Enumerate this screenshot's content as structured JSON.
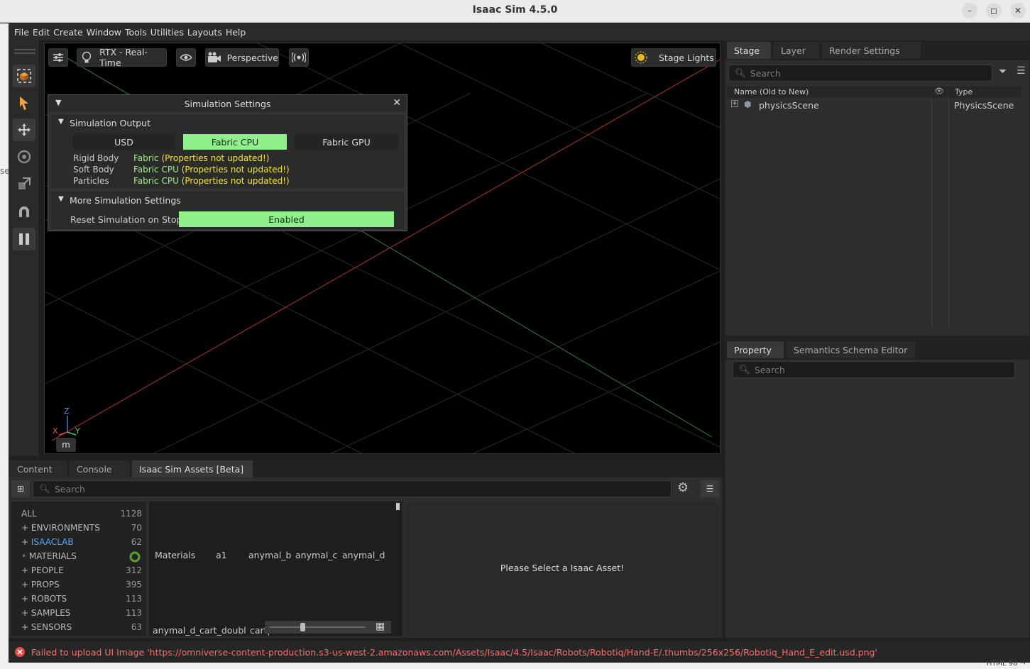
{
  "window": {
    "title": "Isaac Sim 4.5.0"
  },
  "menu": [
    "File",
    "Edit",
    "Create",
    "Window",
    "Tools",
    "Utilities",
    "Layouts",
    "Help"
  ],
  "left_edge_cut_text": "se",
  "viewport": {
    "render_mode": "RTX - Real-Time",
    "camera": "Perspective",
    "lights": "Stage Lights",
    "unit": "m",
    "axes": {
      "z": "Z",
      "x": "X",
      "y": "Y"
    }
  },
  "sim_settings": {
    "title": "Simulation Settings",
    "output_section": "Simulation Output",
    "modes": [
      "USD",
      "Fabric CPU",
      "Fabric GPU"
    ],
    "selected_mode": "Fabric CPU",
    "rows": [
      {
        "label": "Rigid Body",
        "value": "Fabric",
        "note": "(Properties not updated!)"
      },
      {
        "label": "Soft Body",
        "value": "Fabric CPU",
        "note": "(Properties not updated!)"
      },
      {
        "label": "Particles",
        "value": "Fabric CPU",
        "note": "(Properties not updated!)"
      }
    ],
    "more_section": "More Simulation Settings",
    "reset_label": "Reset Simulation on Stop",
    "reset_value": "Enabled"
  },
  "stage": {
    "tabs": [
      "Stage",
      "Layer",
      "Render Settings"
    ],
    "search_placeholder": "Search",
    "col_name": "Name (Old to New)",
    "col_type": "Type",
    "items": [
      {
        "name": "physicsScene",
        "type": "PhysicsScene"
      }
    ]
  },
  "property": {
    "tabs": [
      "Property",
      "Semantics Schema Editor"
    ],
    "search_placeholder": "Search"
  },
  "assets": {
    "tabs": [
      "Content",
      "Console",
      "Isaac Sim Assets [Beta]"
    ],
    "search_placeholder": "Search",
    "categories": [
      {
        "name": "ALL",
        "count": "1128",
        "prefix": ""
      },
      {
        "name": "ENVIRONMENTS",
        "count": "70",
        "prefix": "+"
      },
      {
        "name": "ISAACLAB",
        "count": "62",
        "prefix": "+"
      },
      {
        "name": "MATERIALS",
        "count": "",
        "prefix": "•"
      },
      {
        "name": "PEOPLE",
        "count": "312",
        "prefix": "+"
      },
      {
        "name": "PROPS",
        "count": "395",
        "prefix": "+"
      },
      {
        "name": "ROBOTS",
        "count": "113",
        "prefix": "+"
      },
      {
        "name": "SAMPLES",
        "count": "113",
        "prefix": "+"
      },
      {
        "name": "SENSORS",
        "count": "63",
        "prefix": "+"
      }
    ],
    "grid_row1": [
      "Materials",
      "a1",
      "anymal_b",
      "anymal_c",
      "anymal_d"
    ],
    "grid_row2": [
      "anymal_d_",
      "cart_doubl",
      "cartpole",
      "",
      ""
    ],
    "detail_message": "Please Select a Isaac Asset!"
  },
  "status": {
    "message": "Failed to upload UI Image 'https://omniverse-content-production.s3-us-west-2.amazonaws.com/Assets/Isaac/4.5/Isaac/Robots/Robotiq/Hand-E/.thumbs/256x256/Robotiq_Hand_E_edit.usd.png'",
    "corner": "HTML  98 ¬"
  },
  "colors": {
    "accent_green": "#8ef08b",
    "error_red": "#ff6b6b",
    "link_blue": "#4aa8ff"
  }
}
